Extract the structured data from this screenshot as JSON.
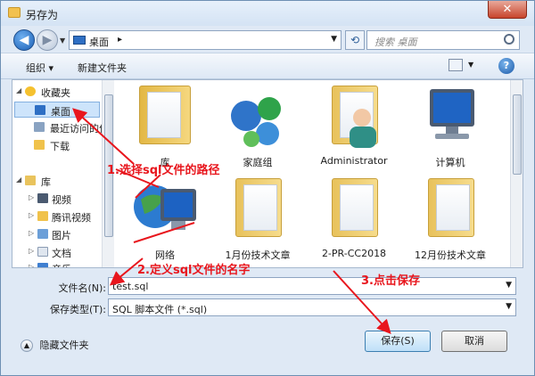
{
  "window": {
    "title": "另存为",
    "close_label": "✕"
  },
  "address": {
    "location": "桌面",
    "separator": "▸"
  },
  "search": {
    "placeholder": "搜索 桌面"
  },
  "toolbar": {
    "organize": "组织 ▾",
    "new_folder": "新建文件夹"
  },
  "sidebar": {
    "items": [
      {
        "label": "收藏夹"
      },
      {
        "label": "桌面"
      },
      {
        "label": "最近访问的位"
      },
      {
        "label": "下载"
      },
      {
        "label": "库"
      },
      {
        "label": "视频"
      },
      {
        "label": "腾讯视频"
      },
      {
        "label": "图片"
      },
      {
        "label": "文档"
      },
      {
        "label": "音乐"
      }
    ]
  },
  "files": [
    {
      "label": "库"
    },
    {
      "label": "家庭组"
    },
    {
      "label": "Administrator"
    },
    {
      "label": "计算机"
    },
    {
      "label": "网络"
    },
    {
      "label": "1月份技术文章"
    },
    {
      "label": "2-PR-CC2018"
    },
    {
      "label": "12月份技术文章"
    }
  ],
  "form": {
    "filename_label": "文件名(N):",
    "filename_value": "test.sql",
    "filetype_label": "保存类型(T):",
    "filetype_value": "SQL 脚本文件 (*.sql)"
  },
  "footer": {
    "hide_folders": "隐藏文件夹",
    "save": "保存(S)",
    "cancel": "取消"
  },
  "annotations": {
    "step1": "1.选择sql文件的路径",
    "step2": "2.定义sql文件的名字",
    "step3": "3.点击保存",
    "color": "#e8161d"
  }
}
